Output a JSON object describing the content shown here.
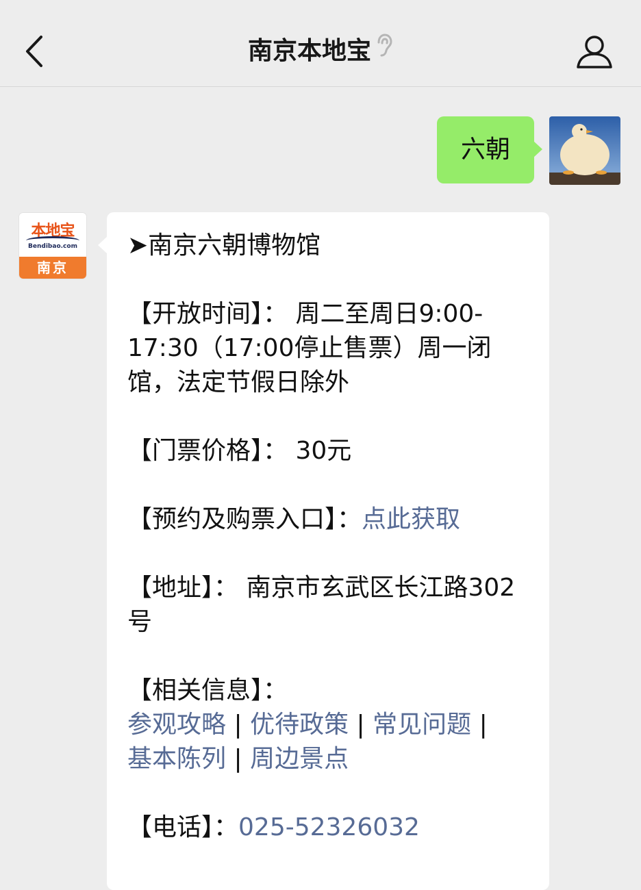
{
  "header": {
    "title": "南京本地宝"
  },
  "outgoing_message": {
    "text": "六朝"
  },
  "account_avatar": {
    "logo_main": "本地宝",
    "logo_sub": "Bendibao.com",
    "logo_city": "南京"
  },
  "reply": {
    "heading": "➤南京六朝博物馆",
    "hours_label": "【开放时间】：",
    "hours_value": "周二至周日9:00-17:30（17:00停止售票）周一闭馆，法定节假日除外",
    "price_label": "【门票价格】：",
    "price_value": "30元",
    "booking_label": "【预约及购票入口】：",
    "booking_link": "点此获取",
    "address_label": "【地址】：",
    "address_value": "南京市玄武区长江路302号",
    "info_label": "【相关信息】：",
    "info_links": [
      "参观攻略",
      "优待政策",
      "常见问题",
      "基本陈列",
      "周边景点"
    ],
    "separator": "|",
    "phone_label": "【电话】：",
    "phone_value": "025-52326032"
  },
  "colors": {
    "background": "#ededed",
    "outgoing_bubble": "#95ec69",
    "incoming_bubble": "#ffffff",
    "link": "#576b95",
    "logo_orange": "#f07b2d"
  }
}
